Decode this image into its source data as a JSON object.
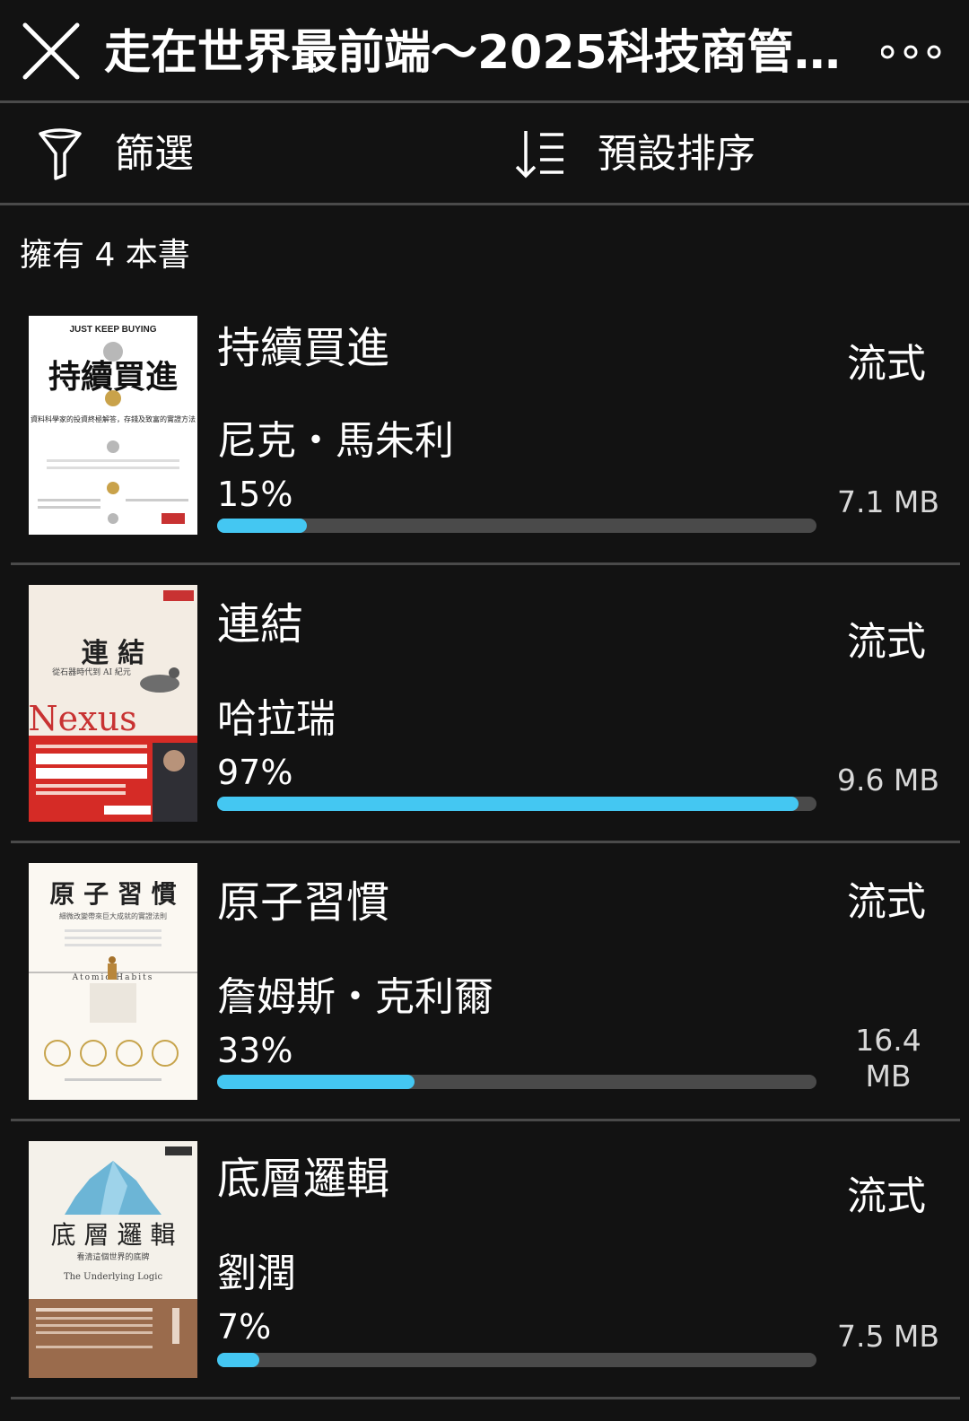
{
  "header": {
    "title": "走在世界最前端～2025科技商管閱...",
    "close_icon": "close-icon",
    "more_icon": "more-horizontal-icon"
  },
  "toolbar": {
    "filter_label": "篩選",
    "filter_icon": "filter-funnel-icon",
    "sort_label": "預設排序",
    "sort_icon": "sort-descending-icon"
  },
  "library": {
    "count_text": "擁有 4 本書"
  },
  "colors": {
    "background": "#121212",
    "divider": "#4a4a4a",
    "progress_fill": "#44c7f2",
    "progress_track": "#4a4a4a"
  },
  "books": [
    {
      "title": "持續買進",
      "author": "尼克・馬朱利",
      "progress_text": "15%",
      "progress": 0.15,
      "format": "流式",
      "size": "7.1 MB",
      "cover": {
        "headline": "持續買進",
        "tagline": "JUST KEEP BUYING",
        "sub": "資料科學家的投資終極解答，存錢及致富的實證方法"
      }
    },
    {
      "title": "連結",
      "author": "哈拉瑞",
      "progress_text": "97%",
      "progress": 0.97,
      "format": "流式",
      "size": "9.6 MB",
      "cover": {
        "headline": "連 結",
        "tagline": "Nexus",
        "sub": "從石器時代到 AI 紀元"
      }
    },
    {
      "title": "原子習慣",
      "author": "詹姆斯・克利爾",
      "progress_text": "33%",
      "progress": 0.33,
      "format": "流式",
      "size": "16.4 MB",
      "cover": {
        "headline": "原 子 習 慣",
        "tagline": "Atomic Habits",
        "sub": "細微改變帶來巨大成就的實證法則"
      }
    },
    {
      "title": "底層邏輯",
      "author": "劉潤",
      "progress_text": "7%",
      "progress": 0.07,
      "format": "流式",
      "size": "7.5 MB",
      "cover": {
        "headline": "底 層 邏 輯",
        "tagline": "The Underlying Logic",
        "sub": "看清這個世界的底牌"
      }
    }
  ]
}
